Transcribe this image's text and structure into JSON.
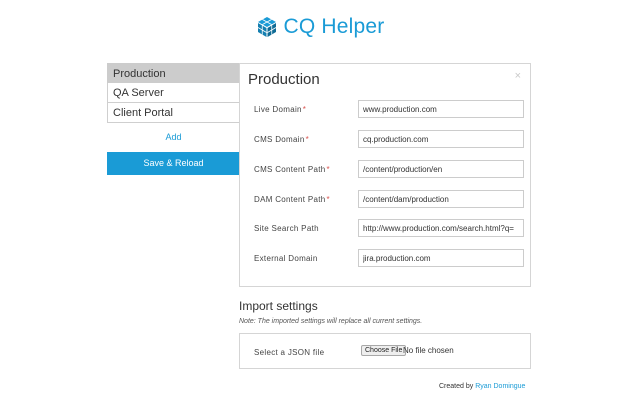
{
  "app": {
    "title": "CQ Helper",
    "icon": "cube-icon",
    "accent": "#1a9bd6"
  },
  "sidebar": {
    "items": [
      {
        "label": "Production",
        "active": true
      },
      {
        "label": "QA Server",
        "active": false
      },
      {
        "label": "Client Portal",
        "active": false
      }
    ],
    "add_label": "Add",
    "save_label": "Save & Reload"
  },
  "panel": {
    "title": "Production",
    "close_glyph": "×",
    "fields": [
      {
        "label": "Live Domain",
        "required": true,
        "value": "www.production.com"
      },
      {
        "label": "CMS Domain",
        "required": true,
        "value": "cq.production.com"
      },
      {
        "label": "CMS Content Path",
        "required": true,
        "value": "/content/production/en"
      },
      {
        "label": "DAM Content Path",
        "required": true,
        "value": "/content/dam/production"
      },
      {
        "label": "Site Search Path",
        "required": false,
        "value": "http://www.production.com/search.html?q="
      },
      {
        "label": "External Domain",
        "required": false,
        "value": "jira.production.com"
      }
    ]
  },
  "import": {
    "title": "Import settings",
    "note": "Note: The imported settings will replace all current settings.",
    "file_label": "Select a JSON file",
    "choose_label": "Choose File",
    "no_file": "No file chosen"
  },
  "footer": {
    "prefix": "Created by",
    "author": "Ryan Domingue"
  }
}
